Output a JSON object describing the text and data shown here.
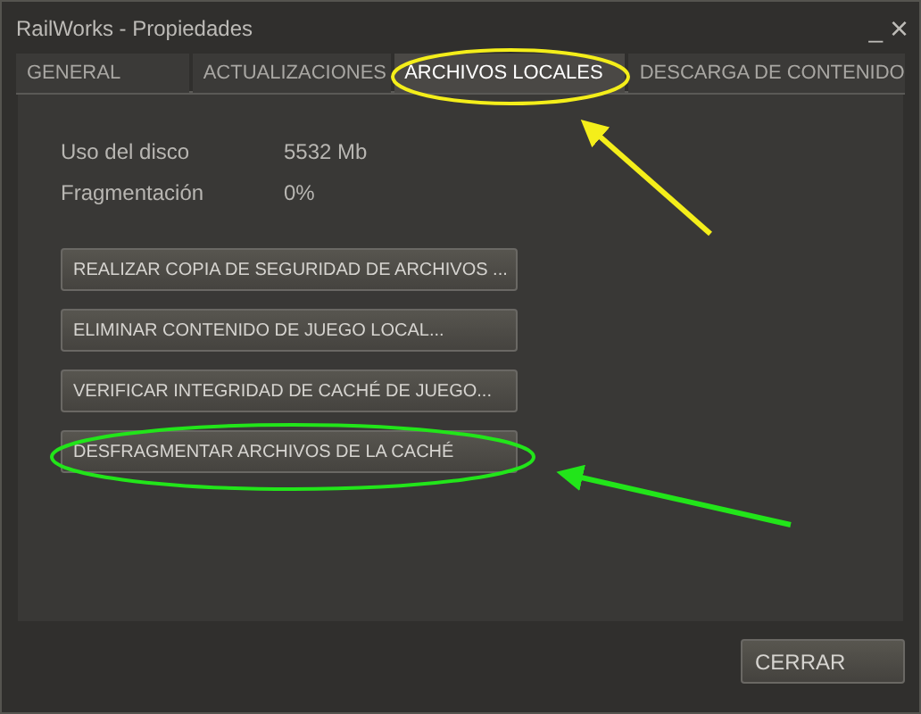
{
  "window": {
    "title": "RailWorks - Propiedades",
    "controls": [
      "_",
      "×"
    ]
  },
  "tabs": [
    {
      "label": "GENERAL",
      "selected": false
    },
    {
      "label": "ACTUALIZACIONES",
      "selected": false
    },
    {
      "label": "ARCHIVOS LOCALES",
      "selected": true
    },
    {
      "label": "DESCARGA DE CONTENIDO",
      "selected": false
    }
  ],
  "info": [
    {
      "label": "Uso del disco",
      "value": "5532 Mb"
    },
    {
      "label": "Fragmentación",
      "value": "0%"
    }
  ],
  "actions": [
    "REALIZAR COPIA DE SEGURIDAD DE ARCHIVOS ...",
    "ELIMINAR CONTENIDO DE JUEGO LOCAL...",
    "VERIFICAR INTEGRIDAD DE CACHÉ DE JUEGO...",
    "DESFRAGMENTAR ARCHIVOS DE LA CACHÉ"
  ],
  "close_button": "CERRAR"
}
